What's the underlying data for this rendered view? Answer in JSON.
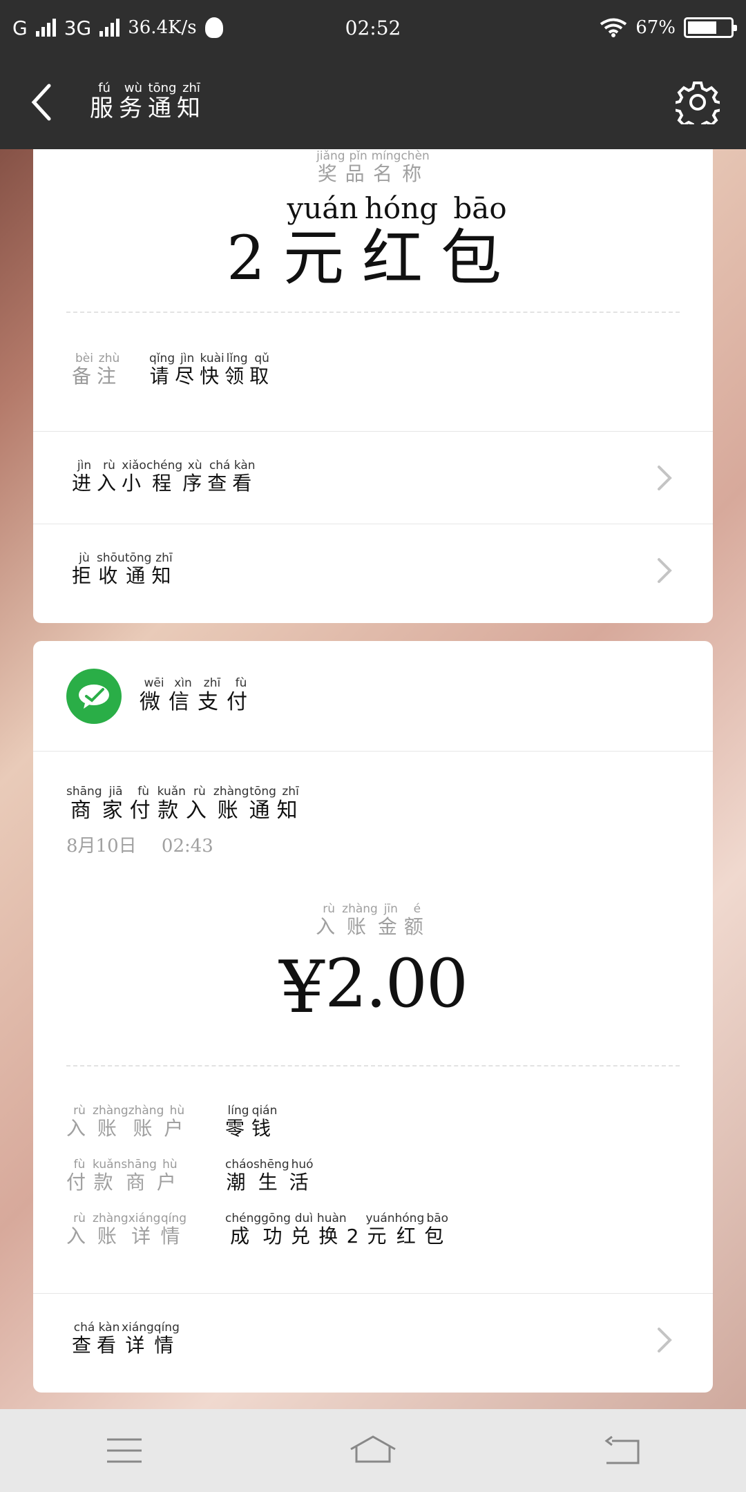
{
  "status_bar": {
    "network1": "G",
    "network2": "3G",
    "speed": "36.4K/s",
    "time": "02:52",
    "battery": "67%"
  },
  "app_bar": {
    "title": [
      {
        "c": "服",
        "p": "fú"
      },
      {
        "c": "务",
        "p": "wù"
      },
      {
        "c": "通",
        "p": "tōng"
      },
      {
        "c": "知",
        "p": "zhī"
      }
    ]
  },
  "card1": {
    "prize_label": [
      {
        "c": "奖",
        "p": "jiǎng"
      },
      {
        "c": "品",
        "p": "pǐn"
      },
      {
        "c": "名",
        "p": "míng"
      },
      {
        "c": "称",
        "p": "chèn"
      }
    ],
    "prize_value": [
      {
        "c": "2",
        "p": ""
      },
      {
        "c": "元",
        "p": "yuán"
      },
      {
        "c": "红",
        "p": "hóng"
      },
      {
        "c": "包",
        "p": "bāo"
      }
    ],
    "note_key": [
      {
        "c": "备",
        "p": "bèi"
      },
      {
        "c": "注",
        "p": "zhù"
      }
    ],
    "note_value": [
      {
        "c": "请",
        "p": "qǐng"
      },
      {
        "c": "尽",
        "p": "jìn"
      },
      {
        "c": "快",
        "p": "kuài"
      },
      {
        "c": "领",
        "p": "lǐng"
      },
      {
        "c": "取",
        "p": "qǔ"
      }
    ],
    "row_miniprogram": [
      {
        "c": "进",
        "p": "jìn"
      },
      {
        "c": "入",
        "p": "rù"
      },
      {
        "c": "小",
        "p": "xiǎo"
      },
      {
        "c": "程",
        "p": "chéng"
      },
      {
        "c": "序",
        "p": "xù"
      },
      {
        "c": "查",
        "p": "chá"
      },
      {
        "c": "看",
        "p": "kàn"
      }
    ],
    "row_reject": [
      {
        "c": "拒",
        "p": "jù"
      },
      {
        "c": "收",
        "p": "shōu"
      },
      {
        "c": "通",
        "p": "tōng"
      },
      {
        "c": "知",
        "p": "zhī"
      }
    ]
  },
  "card2": {
    "brand": [
      {
        "c": "微",
        "p": "wēi"
      },
      {
        "c": "信",
        "p": "xìn"
      },
      {
        "c": "支",
        "p": "zhī"
      },
      {
        "c": "付",
        "p": "fù"
      }
    ],
    "notice_title": [
      {
        "c": "商",
        "p": "shāng"
      },
      {
        "c": "家",
        "p": "jiā"
      },
      {
        "c": "付",
        "p": "fù"
      },
      {
        "c": "款",
        "p": "kuǎn"
      },
      {
        "c": "入",
        "p": "rù"
      },
      {
        "c": "账",
        "p": "zhàng"
      },
      {
        "c": "通",
        "p": "tōng"
      },
      {
        "c": "知",
        "p": "zhī"
      }
    ],
    "date": "8月10日",
    "time": "02:43",
    "amount_label": [
      {
        "c": "入",
        "p": "rù"
      },
      {
        "c": "账",
        "p": "zhàng"
      },
      {
        "c": "金",
        "p": "jīn"
      },
      {
        "c": "额",
        "p": "é"
      }
    ],
    "currency": "¥",
    "amount": "2.00",
    "details": [
      {
        "key": [
          {
            "c": "入",
            "p": "rù"
          },
          {
            "c": "账",
            "p": "zhàng"
          },
          {
            "c": "账",
            "p": "zhàng"
          },
          {
            "c": "户",
            "p": "hù"
          }
        ],
        "value": [
          {
            "c": "零",
            "p": "líng"
          },
          {
            "c": "钱",
            "p": "qián"
          }
        ]
      },
      {
        "key": [
          {
            "c": "付",
            "p": "fù"
          },
          {
            "c": "款",
            "p": "kuǎn"
          },
          {
            "c": "商",
            "p": "shāng"
          },
          {
            "c": "户",
            "p": "hù"
          }
        ],
        "value": [
          {
            "c": "潮",
            "p": "cháo"
          },
          {
            "c": "生",
            "p": "shēng"
          },
          {
            "c": "活",
            "p": "huó"
          }
        ]
      },
      {
        "key": [
          {
            "c": "入",
            "p": "rù"
          },
          {
            "c": "账",
            "p": "zhàng"
          },
          {
            "c": "详",
            "p": "xiáng"
          },
          {
            "c": "情",
            "p": "qíng"
          }
        ],
        "value": [
          {
            "c": "成",
            "p": "chéng"
          },
          {
            "c": "功",
            "p": "gōng"
          },
          {
            "c": "兑",
            "p": "duì"
          },
          {
            "c": "换",
            "p": "huàn"
          },
          {
            "c": "2",
            "p": ""
          },
          {
            "c": "元",
            "p": "yuán"
          },
          {
            "c": "红",
            "p": "hóng"
          },
          {
            "c": "包",
            "p": "bāo"
          }
        ]
      }
    ],
    "row_details": [
      {
        "c": "查",
        "p": "chá"
      },
      {
        "c": "看",
        "p": "kàn"
      },
      {
        "c": "详",
        "p": "xiáng"
      },
      {
        "c": "情",
        "p": "qíng"
      }
    ]
  },
  "colors": {
    "bar": "#2f2f2f",
    "wechat_green": "#2aae47",
    "muted_text": "#a0a0a0"
  },
  "icons": {
    "back": "chevron-left-icon",
    "settings": "gear-icon",
    "row_arrow": "chevron-right-icon",
    "wechat_pay": "wechat-pay-icon",
    "nav_menu": "menu-icon",
    "nav_home": "home-icon",
    "nav_back": "back-arrow-icon"
  }
}
